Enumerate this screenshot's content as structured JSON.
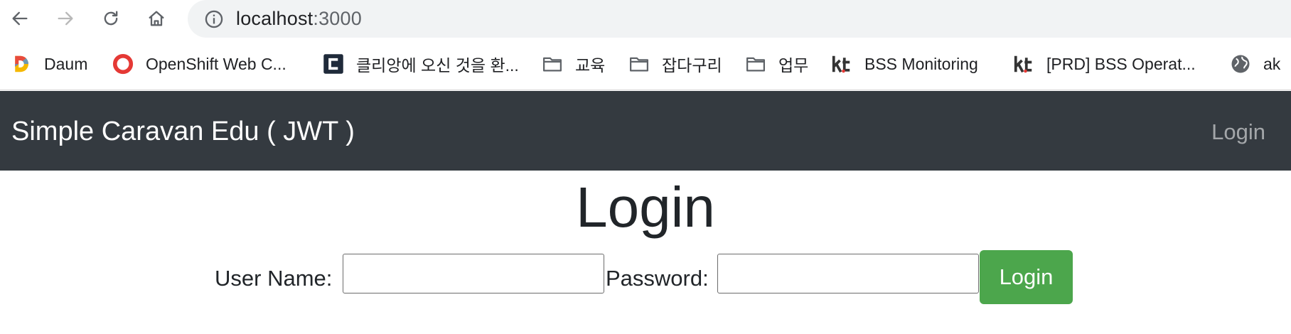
{
  "browser": {
    "address": {
      "host": "localhost",
      "port": ":3000"
    },
    "bookmarks": [
      {
        "label": "Daum",
        "icon": "daum-icon"
      },
      {
        "label": "OpenShift Web C...",
        "icon": "openshift-icon"
      },
      {
        "label": "클리앙에 오신 것을 환...",
        "icon": "clien-icon"
      },
      {
        "label": "교육",
        "icon": "folder-icon"
      },
      {
        "label": "잡다구리",
        "icon": "folder-icon"
      },
      {
        "label": "업무",
        "icon": "folder-icon"
      },
      {
        "label": "BSS Monitoring",
        "icon": "kt-icon"
      },
      {
        "label": "[PRD] BSS Operat...",
        "icon": "kt-icon"
      },
      {
        "label": "ak",
        "icon": "globe-icon"
      }
    ]
  },
  "navbar": {
    "brand": "Simple Caravan Edu ( JWT )",
    "login_link": "Login"
  },
  "main": {
    "title": "Login",
    "username_label": "User Name:",
    "username_value": "",
    "password_label": "Password:",
    "password_value": "",
    "login_button": "Login"
  },
  "colors": {
    "navbar_bg": "#343a40",
    "button_bg": "#4ca64c",
    "address_bar_bg": "#f1f3f4"
  }
}
